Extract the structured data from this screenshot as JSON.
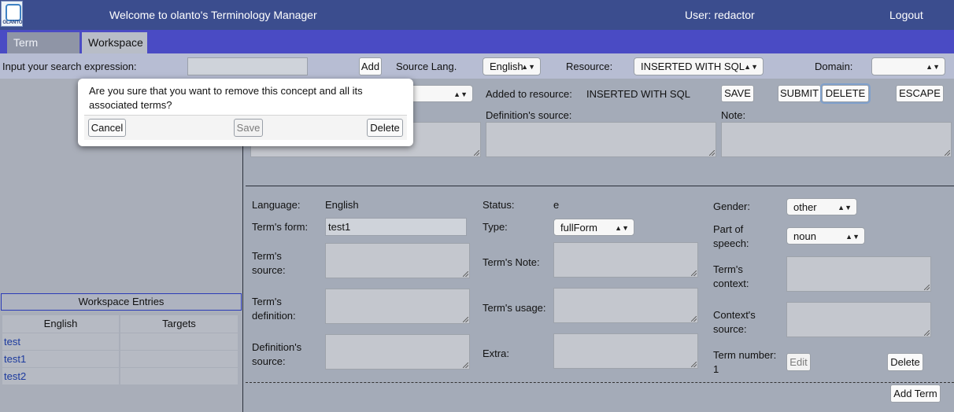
{
  "header": {
    "logo_text": "OLANTO",
    "title": "Welcome to olanto's Terminology Manager",
    "user": "User: redactor",
    "logout": "Logout"
  },
  "tabs": [
    {
      "label": "Term Search",
      "active": false
    },
    {
      "label": "Workspace",
      "active": true
    }
  ],
  "search": {
    "label": "Input your search expression:",
    "value": "",
    "add_button": "Add",
    "source_lang_label": "Source Lang.",
    "source_lang": "English",
    "resource_label": "Resource:",
    "resource": "INSERTED WITH SQL",
    "domain_label": "Domain:",
    "domain": ""
  },
  "concept": {
    "added_to_resource_label": "Added to resource:",
    "added_to_resource": "INSERTED WITH SQL",
    "buttons": {
      "save": "SAVE",
      "submit": "SUBMIT",
      "delete": "DELETE",
      "escape": "ESCAPE"
    },
    "definition_source_label": "Definition's source:",
    "note_label": "Note:"
  },
  "modal": {
    "message": "Are you sure that you want to remove this concept and all its associated terms?",
    "cancel": "Cancel",
    "save": "Save",
    "delete": "Delete"
  },
  "workspace": {
    "header": "Workspace Entries",
    "columns": [
      "English",
      "Targets"
    ],
    "rows": [
      {
        "english": "test",
        "targets": ""
      },
      {
        "english": "test1",
        "targets": ""
      },
      {
        "english": "test2",
        "targets": ""
      }
    ]
  },
  "term": {
    "language_label": "Language:",
    "language": "English",
    "status_label": "Status:",
    "status": "e",
    "gender_label": "Gender:",
    "gender": "other",
    "form_label": "Term's form:",
    "form": "test1",
    "type_label": "Type:",
    "type": "fullForm",
    "pos_label": "Part of speech:",
    "pos": "noun",
    "source_label": "Term's source:",
    "note_label": "Term's Note:",
    "context_label": "Term's context:",
    "definition_label": "Term's definition:",
    "usage_label": "Term's usage:",
    "context_source_label": "Context's source:",
    "def_source_label": "Definition's source:",
    "extra_label": "Extra:",
    "number_label": "Term number:",
    "number": "1",
    "edit_button": "Edit",
    "delete_button": "Delete",
    "add_term_button": "Add Term"
  }
}
